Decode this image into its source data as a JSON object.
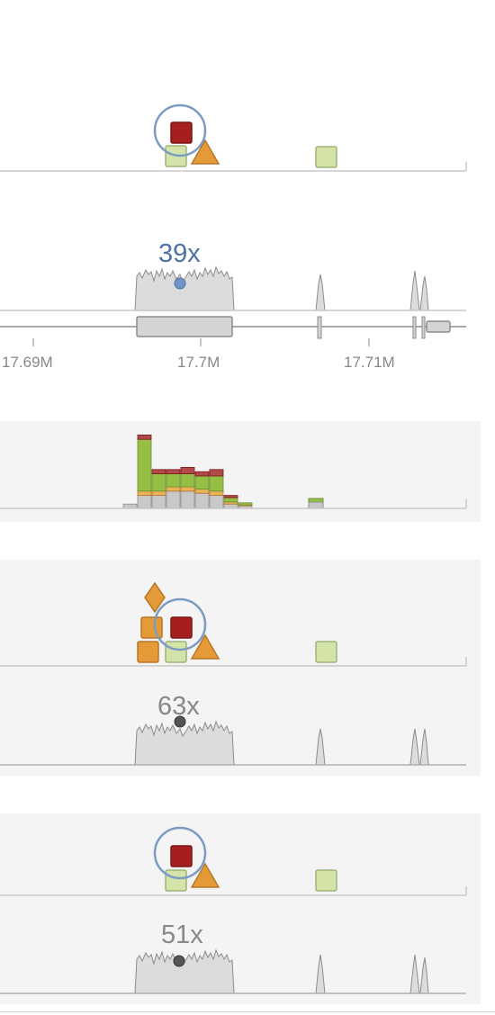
{
  "colors": {
    "page_background": "#ffffff",
    "panel_background": "#f4f4f4",
    "axis_line": "#c8c8c8",
    "highlight_ring": "#7b9cc2",
    "pathogenic": "#a51f1f",
    "likely_pathogenic": "#e39a37",
    "uncertain": "#d4e3a7",
    "benign_green": "#95c045",
    "coverage_fill": "#dcdcdc",
    "coverage_stroke": "#8c8c8c",
    "gene_fill": "#d4d4d4",
    "gene_stroke": "#8c8c8c",
    "coverage_label_blue": "#4d73a3",
    "coverage_label_gray": "#888888",
    "marker_blue": "#6f93c4",
    "marker_dark": "#555555"
  },
  "track1": {
    "variants": [
      {
        "shape": "square",
        "class": "pathogenic",
        "selected": true
      },
      {
        "shape": "square",
        "class": "uncertain"
      },
      {
        "shape": "triangle",
        "class": "likely_pathogenic"
      },
      {
        "shape": "square",
        "class": "uncertain"
      }
    ]
  },
  "coverage_track": {
    "label": "39x",
    "marker_icon": "coverage-dot-icon"
  },
  "gene_axis": {
    "ticks": [
      "17.69M",
      "17.7M",
      "17.71M"
    ]
  },
  "histogram": {
    "bins": [
      {
        "gray": 1,
        "orange": 0,
        "green": 0,
        "red": 0
      },
      {
        "gray": 3,
        "orange": 1,
        "green": 12,
        "red": 1
      },
      {
        "gray": 3,
        "orange": 1,
        "green": 4,
        "red": 1
      },
      {
        "gray": 4,
        "orange": 1,
        "green": 3,
        "red": 1
      },
      {
        "gray": 4,
        "orange": 1,
        "green": 3,
        "red": 1.5
      },
      {
        "gray": 3.5,
        "orange": 1,
        "green": 3,
        "red": 1
      },
      {
        "gray": 3,
        "orange": 1,
        "green": 3.5,
        "red": 1.5
      },
      {
        "gray": 1,
        "orange": 0.5,
        "green": 1,
        "red": 0.5
      },
      {
        "gray": 0.6,
        "orange": 0.2,
        "green": 0.5,
        "red": 0
      }
    ]
  },
  "sample1": {
    "variants": [
      {
        "shape": "diamond",
        "class": "likely_pathogenic"
      },
      {
        "shape": "square",
        "class": "likely_pathogenic"
      },
      {
        "shape": "square",
        "class": "pathogenic",
        "selected": true
      },
      {
        "shape": "square",
        "class": "likely_pathogenic"
      },
      {
        "shape": "square",
        "class": "uncertain"
      },
      {
        "shape": "triangle",
        "class": "likely_pathogenic"
      },
      {
        "shape": "square",
        "class": "uncertain"
      }
    ],
    "coverage_label": "63x"
  },
  "sample2": {
    "variants": [
      {
        "shape": "square",
        "class": "pathogenic",
        "selected": true
      },
      {
        "shape": "square",
        "class": "uncertain"
      },
      {
        "shape": "triangle",
        "class": "likely_pathogenic"
      },
      {
        "shape": "square",
        "class": "uncertain"
      }
    ],
    "coverage_label": "51x"
  }
}
